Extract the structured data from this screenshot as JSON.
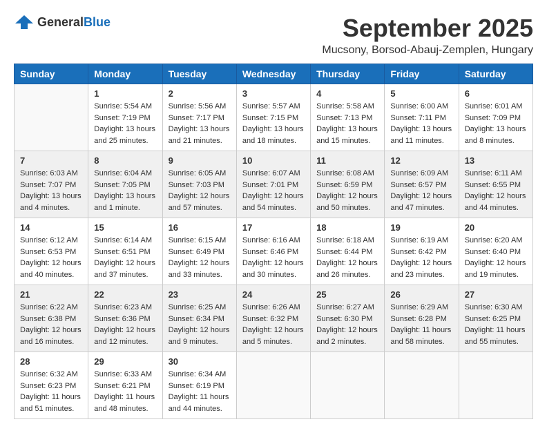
{
  "header": {
    "logo_general": "General",
    "logo_blue": "Blue",
    "month_title": "September 2025",
    "location": "Mucsony, Borsod-Abauj-Zemplen, Hungary"
  },
  "weekdays": [
    "Sunday",
    "Monday",
    "Tuesday",
    "Wednesday",
    "Thursday",
    "Friday",
    "Saturday"
  ],
  "weeks": [
    [
      {
        "day": "",
        "info": ""
      },
      {
        "day": "1",
        "info": "Sunrise: 5:54 AM\nSunset: 7:19 PM\nDaylight: 13 hours\nand 25 minutes."
      },
      {
        "day": "2",
        "info": "Sunrise: 5:56 AM\nSunset: 7:17 PM\nDaylight: 13 hours\nand 21 minutes."
      },
      {
        "day": "3",
        "info": "Sunrise: 5:57 AM\nSunset: 7:15 PM\nDaylight: 13 hours\nand 18 minutes."
      },
      {
        "day": "4",
        "info": "Sunrise: 5:58 AM\nSunset: 7:13 PM\nDaylight: 13 hours\nand 15 minutes."
      },
      {
        "day": "5",
        "info": "Sunrise: 6:00 AM\nSunset: 7:11 PM\nDaylight: 13 hours\nand 11 minutes."
      },
      {
        "day": "6",
        "info": "Sunrise: 6:01 AM\nSunset: 7:09 PM\nDaylight: 13 hours\nand 8 minutes."
      }
    ],
    [
      {
        "day": "7",
        "info": "Sunrise: 6:03 AM\nSunset: 7:07 PM\nDaylight: 13 hours\nand 4 minutes."
      },
      {
        "day": "8",
        "info": "Sunrise: 6:04 AM\nSunset: 7:05 PM\nDaylight: 13 hours\nand 1 minute."
      },
      {
        "day": "9",
        "info": "Sunrise: 6:05 AM\nSunset: 7:03 PM\nDaylight: 12 hours\nand 57 minutes."
      },
      {
        "day": "10",
        "info": "Sunrise: 6:07 AM\nSunset: 7:01 PM\nDaylight: 12 hours\nand 54 minutes."
      },
      {
        "day": "11",
        "info": "Sunrise: 6:08 AM\nSunset: 6:59 PM\nDaylight: 12 hours\nand 50 minutes."
      },
      {
        "day": "12",
        "info": "Sunrise: 6:09 AM\nSunset: 6:57 PM\nDaylight: 12 hours\nand 47 minutes."
      },
      {
        "day": "13",
        "info": "Sunrise: 6:11 AM\nSunset: 6:55 PM\nDaylight: 12 hours\nand 44 minutes."
      }
    ],
    [
      {
        "day": "14",
        "info": "Sunrise: 6:12 AM\nSunset: 6:53 PM\nDaylight: 12 hours\nand 40 minutes."
      },
      {
        "day": "15",
        "info": "Sunrise: 6:14 AM\nSunset: 6:51 PM\nDaylight: 12 hours\nand 37 minutes."
      },
      {
        "day": "16",
        "info": "Sunrise: 6:15 AM\nSunset: 6:49 PM\nDaylight: 12 hours\nand 33 minutes."
      },
      {
        "day": "17",
        "info": "Sunrise: 6:16 AM\nSunset: 6:46 PM\nDaylight: 12 hours\nand 30 minutes."
      },
      {
        "day": "18",
        "info": "Sunrise: 6:18 AM\nSunset: 6:44 PM\nDaylight: 12 hours\nand 26 minutes."
      },
      {
        "day": "19",
        "info": "Sunrise: 6:19 AM\nSunset: 6:42 PM\nDaylight: 12 hours\nand 23 minutes."
      },
      {
        "day": "20",
        "info": "Sunrise: 6:20 AM\nSunset: 6:40 PM\nDaylight: 12 hours\nand 19 minutes."
      }
    ],
    [
      {
        "day": "21",
        "info": "Sunrise: 6:22 AM\nSunset: 6:38 PM\nDaylight: 12 hours\nand 16 minutes."
      },
      {
        "day": "22",
        "info": "Sunrise: 6:23 AM\nSunset: 6:36 PM\nDaylight: 12 hours\nand 12 minutes."
      },
      {
        "day": "23",
        "info": "Sunrise: 6:25 AM\nSunset: 6:34 PM\nDaylight: 12 hours\nand 9 minutes."
      },
      {
        "day": "24",
        "info": "Sunrise: 6:26 AM\nSunset: 6:32 PM\nDaylight: 12 hours\nand 5 minutes."
      },
      {
        "day": "25",
        "info": "Sunrise: 6:27 AM\nSunset: 6:30 PM\nDaylight: 12 hours\nand 2 minutes."
      },
      {
        "day": "26",
        "info": "Sunrise: 6:29 AM\nSunset: 6:28 PM\nDaylight: 11 hours\nand 58 minutes."
      },
      {
        "day": "27",
        "info": "Sunrise: 6:30 AM\nSunset: 6:25 PM\nDaylight: 11 hours\nand 55 minutes."
      }
    ],
    [
      {
        "day": "28",
        "info": "Sunrise: 6:32 AM\nSunset: 6:23 PM\nDaylight: 11 hours\nand 51 minutes."
      },
      {
        "day": "29",
        "info": "Sunrise: 6:33 AM\nSunset: 6:21 PM\nDaylight: 11 hours\nand 48 minutes."
      },
      {
        "day": "30",
        "info": "Sunrise: 6:34 AM\nSunset: 6:19 PM\nDaylight: 11 hours\nand 44 minutes."
      },
      {
        "day": "",
        "info": ""
      },
      {
        "day": "",
        "info": ""
      },
      {
        "day": "",
        "info": ""
      },
      {
        "day": "",
        "info": ""
      }
    ]
  ]
}
